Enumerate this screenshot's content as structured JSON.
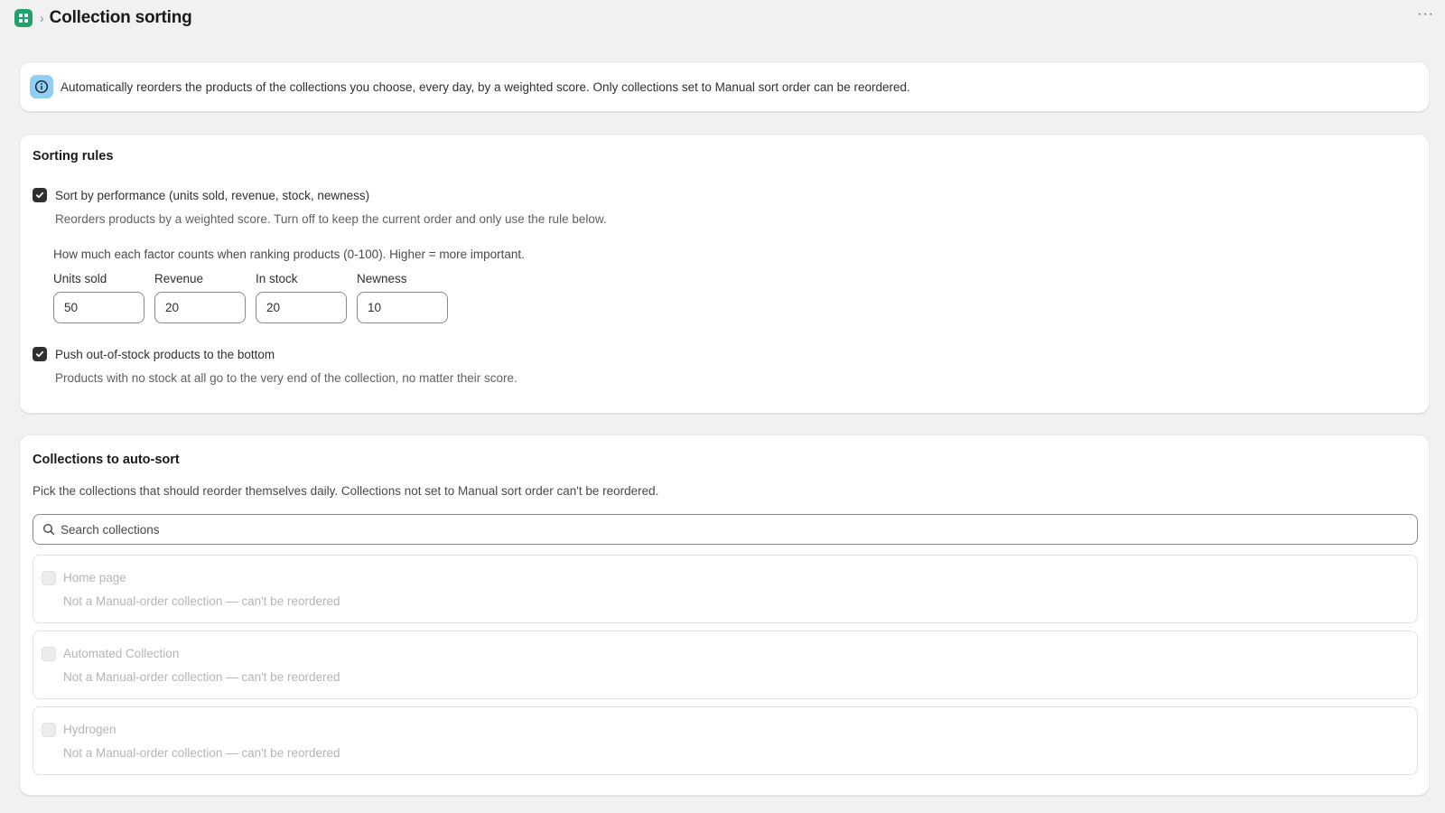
{
  "header": {
    "title": "Collection sorting",
    "more_label": "···"
  },
  "banner": {
    "text": "Automatically reorders the products of the collections you choose, every day, by a weighted score. Only collections set to Manual sort order can be reordered."
  },
  "sorting_rules": {
    "title": "Sorting rules",
    "performance": {
      "label": "Sort by performance (units sold, revenue, stock, newness)",
      "checked": true,
      "help": "Reorders products by a weighted score. Turn off to keep the current order and only use the rule below."
    },
    "weights_intro": "How much each factor counts when ranking products (0-100). Higher = more important.",
    "weights": [
      {
        "label": "Units sold",
        "value": "50"
      },
      {
        "label": "Revenue",
        "value": "20"
      },
      {
        "label": "In stock",
        "value": "20"
      },
      {
        "label": "Newness",
        "value": "10"
      }
    ],
    "out_of_stock": {
      "label": "Push out-of-stock products to the bottom",
      "checked": true,
      "help": "Products with no stock at all go to the very end of the collection, no matter their score."
    }
  },
  "collections": {
    "title": "Collections to auto-sort",
    "description": "Pick the collections that should reorder themselves daily. Collections not set to Manual sort order can't be reordered.",
    "search_placeholder": "Search collections",
    "items": [
      {
        "name": "Home page",
        "note": "Not a Manual-order collection — can't be reordered",
        "disabled": true
      },
      {
        "name": "Automated Collection",
        "note": "Not a Manual-order collection — can't be reordered",
        "disabled": true
      },
      {
        "name": "Hydrogen",
        "note": "Not a Manual-order collection — can't be reordered",
        "disabled": true
      }
    ]
  },
  "colors": {
    "app_icon": "#1fa36a",
    "info_badge": "#91cef5",
    "checkbox_checked": "#303030"
  },
  "icons": [
    "app-icon",
    "chevron-right-icon",
    "more-icon",
    "info-icon",
    "checkmark-icon",
    "search-icon"
  ]
}
